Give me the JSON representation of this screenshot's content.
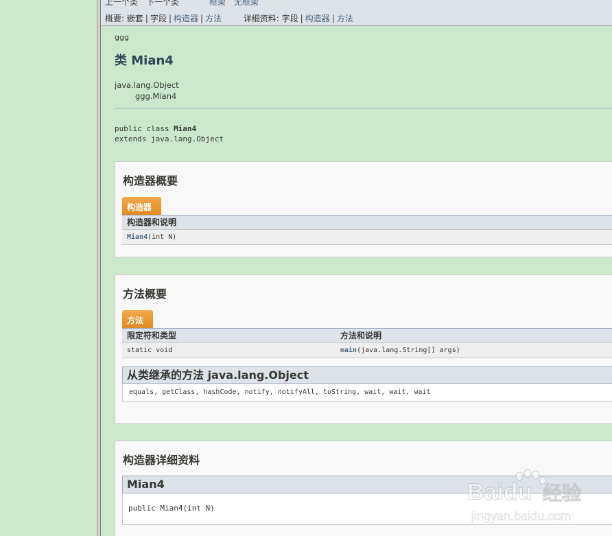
{
  "nav": {
    "prev_class": "上一个类",
    "next_class": "下一个类",
    "frames": "框架",
    "no_frames": "无框架",
    "summary_label": "概要:",
    "summary_nested": "嵌套",
    "summary_field": "字段",
    "summary_constructor": "构造器",
    "summary_method": "方法",
    "detail_label": "详细资料:",
    "detail_field": "字段",
    "detail_constructor": "构造器",
    "detail_method": "方法",
    "separator": "|"
  },
  "header": {
    "package": "ggg",
    "title": "类 Mian4"
  },
  "inheritance": {
    "parent": "java.lang.Object",
    "child": "ggg.Mian4"
  },
  "declaration": {
    "line1_prefix": "public class ",
    "class_name": "Mian4",
    "line2": "extends java.lang.Object"
  },
  "constructor_summary": {
    "heading": "构造器概要",
    "tab": "构造器",
    "column_header": "构造器和说明",
    "rows": [
      {
        "name": "Mian4",
        "params": "(int N)"
      }
    ]
  },
  "method_summary": {
    "heading": "方法概要",
    "tab": "方法",
    "columns": [
      "限定符和类型",
      "方法和说明"
    ],
    "rows": [
      {
        "modifier": "static void",
        "name": "main",
        "params": "(java.lang.String[] args)"
      }
    ],
    "inherited_heading": "从类继承的方法 java.lang.Object",
    "inherited_methods": "equals, getClass, hashCode, notify, notifyAll, toString, wait, wait, wait"
  },
  "constructor_detail": {
    "heading": "构造器详细资料",
    "name": "Mian4",
    "signature": "public Mian4(int N)"
  },
  "watermark": {
    "brand": "Baidu",
    "suffix": "经验",
    "url": "jingyan.baidu.com"
  },
  "colors": {
    "page_bg": "#cce8cc",
    "nav_bg": "#dee3e9",
    "tab_orange": "#f0a040",
    "link": "#4a6782"
  }
}
